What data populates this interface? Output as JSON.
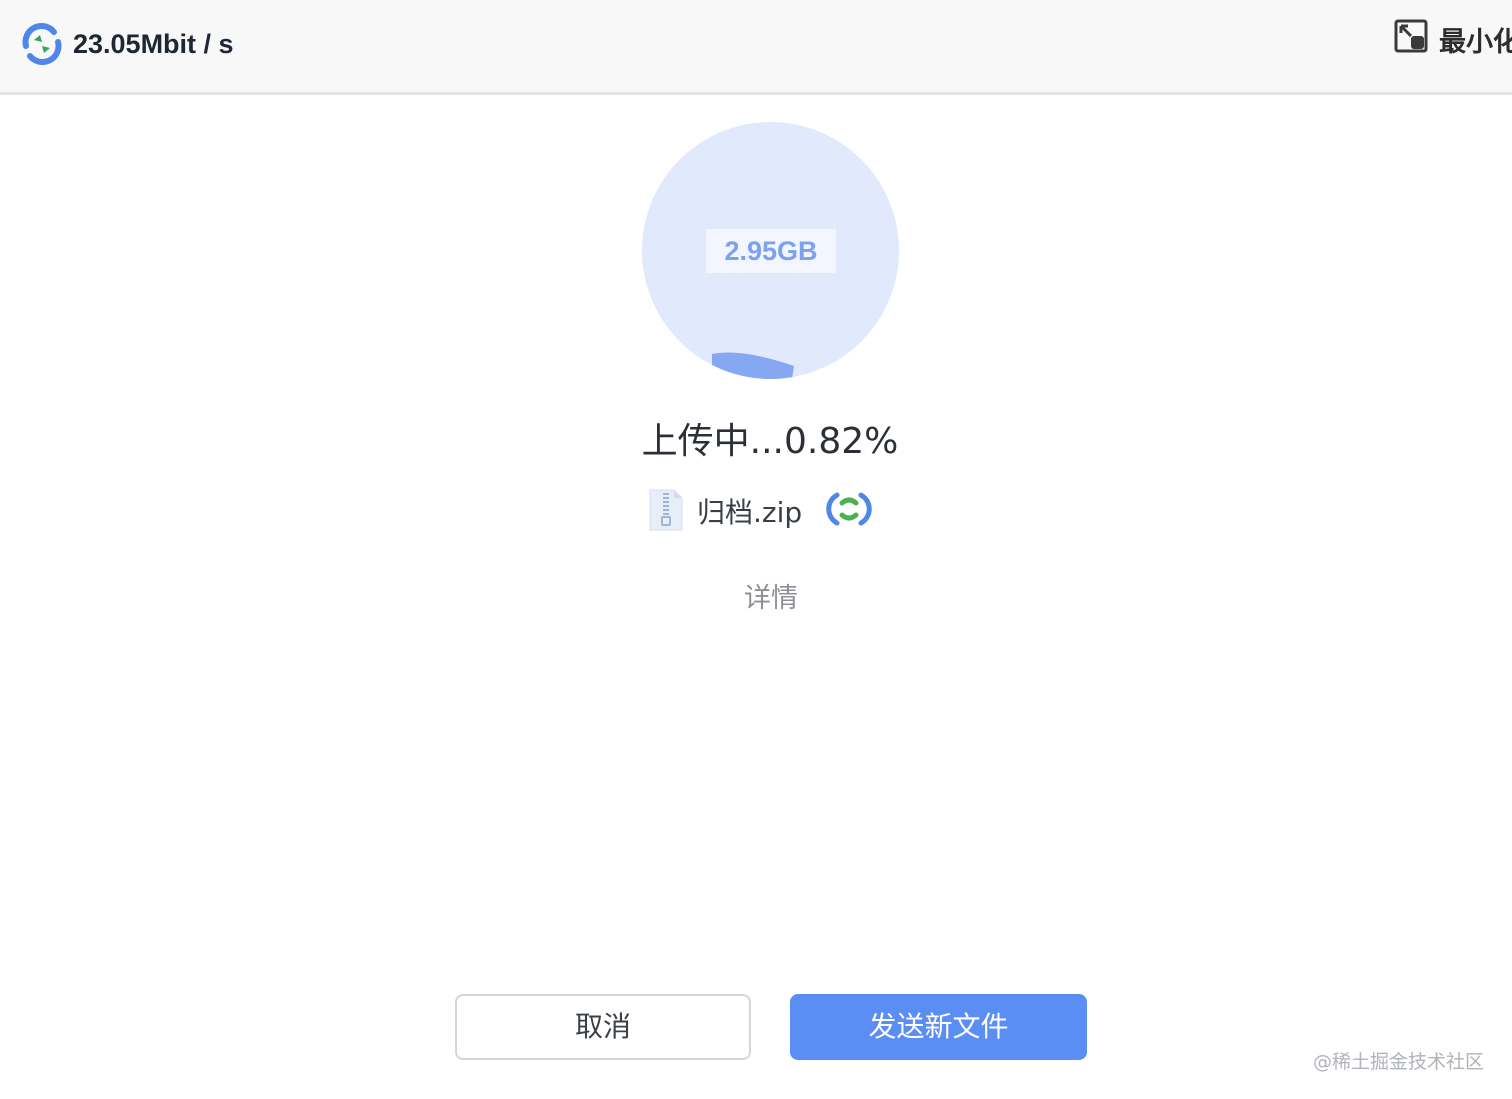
{
  "header": {
    "speed": "23.05Mbit / s",
    "minimize_label": "最小化"
  },
  "transfer": {
    "size": "2.95GB",
    "status": "上传中...0.82%",
    "progress_percent": 0.82,
    "file_name": "归档.zip",
    "details_label": "详情"
  },
  "actions": {
    "cancel_label": "取消",
    "send_new_label": "发送新文件"
  },
  "watermark": "@稀土掘金技术社区",
  "colors": {
    "accent": "#5b8ef5",
    "circle_bg": "#e1e9fd",
    "wave": "#86a8f2",
    "sync_green": "#4caf50"
  },
  "icons": {
    "app_logo": "sync-logo-icon",
    "minimize": "minimize-window-icon",
    "file": "zip-file-icon",
    "sync": "sync-status-icon"
  }
}
